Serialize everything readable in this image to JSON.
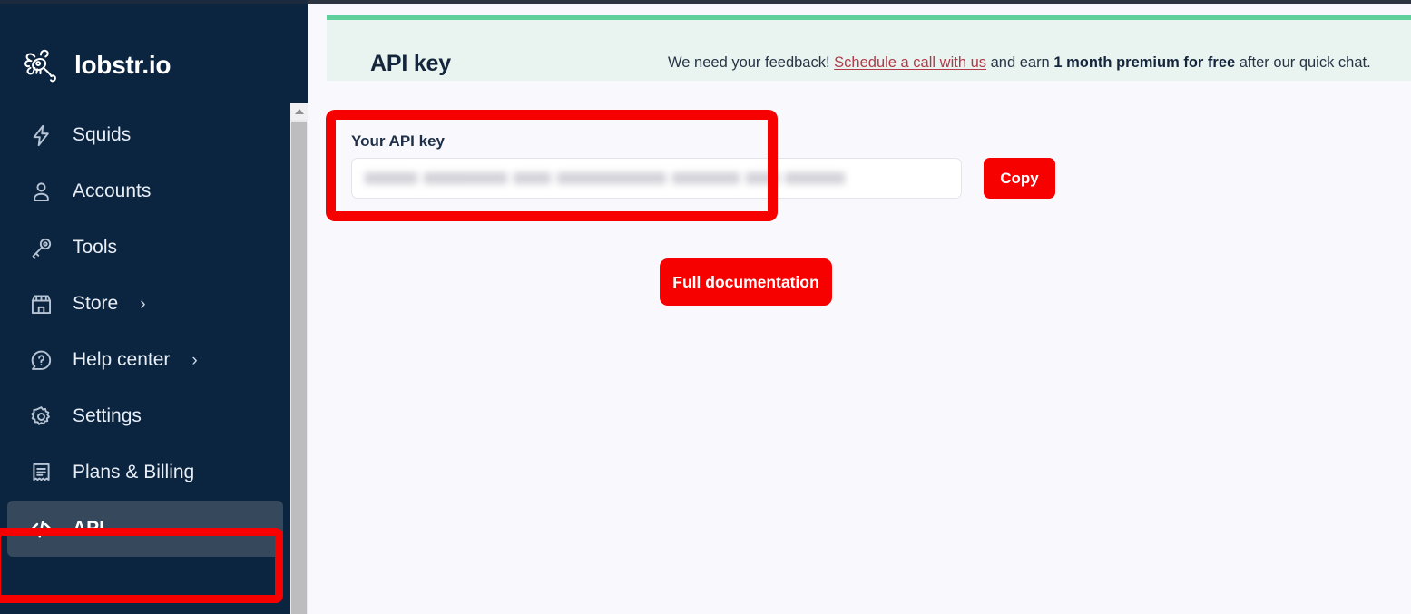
{
  "brand": {
    "name": "lobstr.io",
    "logo_icon": "lobster-icon"
  },
  "sidebar": {
    "items": [
      {
        "id": "squids",
        "label": "Squids",
        "icon": "lightning-bolt-icon",
        "chevron": "",
        "active": false
      },
      {
        "id": "accounts",
        "label": "Accounts",
        "icon": "user-icon",
        "chevron": "",
        "active": false
      },
      {
        "id": "tools",
        "label": "Tools",
        "icon": "key-icon",
        "chevron": "",
        "active": false
      },
      {
        "id": "store",
        "label": "Store",
        "icon": "store-icon",
        "chevron": "›",
        "active": false
      },
      {
        "id": "help-center",
        "label": "Help center",
        "icon": "question-bubble-icon",
        "chevron": "›",
        "active": false
      },
      {
        "id": "settings",
        "label": "Settings",
        "icon": "gear-icon",
        "chevron": "",
        "active": false
      },
      {
        "id": "plans-billing",
        "label": "Plans & Billing",
        "icon": "receipt-icon",
        "chevron": "",
        "active": false
      },
      {
        "id": "api",
        "label": "API",
        "icon": "code-brackets-icon",
        "chevron": "",
        "active": true
      }
    ]
  },
  "banner": {
    "title": "API key",
    "message_prefix": "We need your feedback! ",
    "link_text": "Schedule a call with us",
    "message_middle": " and earn ",
    "message_bold": "1 month premium for free",
    "message_suffix": " after our quick chat.",
    "accent_color": "#5fcf9c",
    "background_color": "#e9f4f0"
  },
  "api_key_card": {
    "label": "Your API key",
    "value_masked": "••••••••••••••••••••••••••••••••",
    "copy_label": "Copy"
  },
  "actions": {
    "full_documentation_label": "Full documentation"
  },
  "annotations": {
    "highlight_color": "#f70000",
    "boxes": [
      "api-key-card",
      "sidebar-item-api"
    ]
  },
  "theme": {
    "sidebar_bg": "#0b2540",
    "sidebar_active_bg": "#36495c",
    "main_bg": "#f8f8fd",
    "primary_button": "#f70000"
  },
  "scrollbar": {
    "arrow_icon": "chevron-up-icon"
  }
}
